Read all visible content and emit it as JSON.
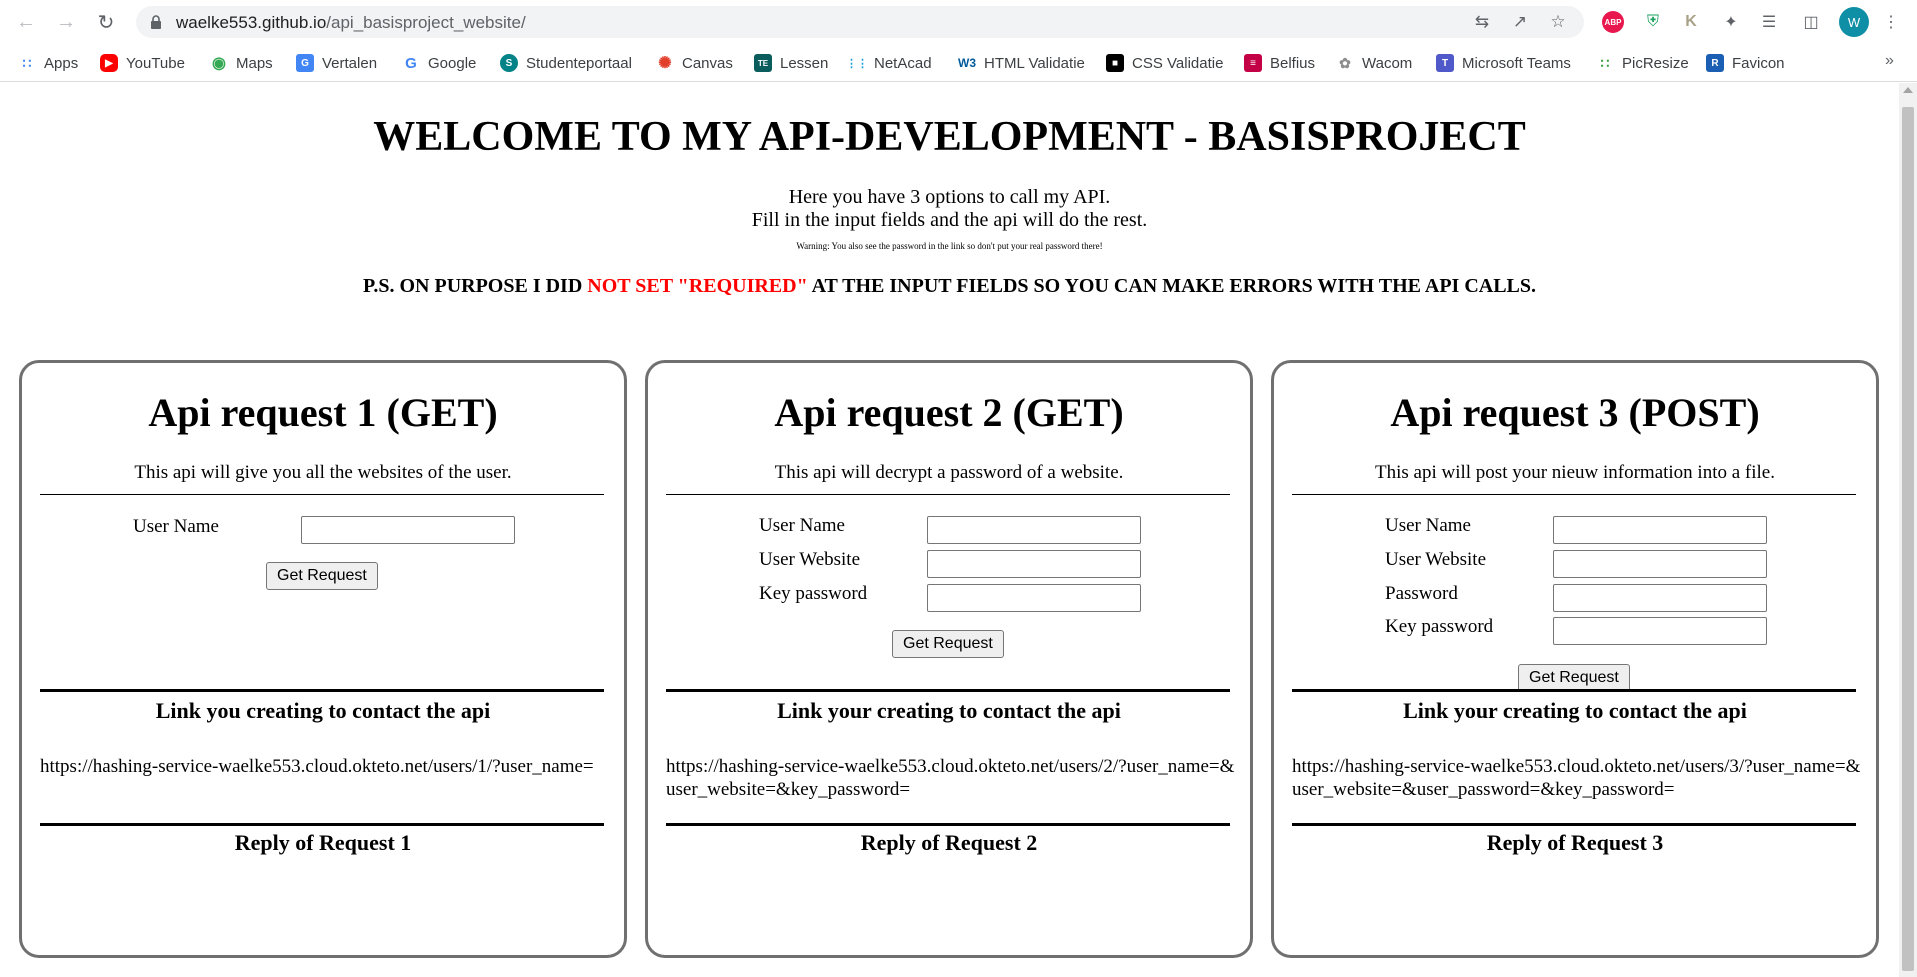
{
  "browser": {
    "url_domain": "waelke553.github.io",
    "url_path": "/api_basisproject_website/",
    "profile_initial": "W",
    "bookmarks": [
      {
        "label": "Apps",
        "icon": "apps-grid-icon",
        "color": "#4285f4"
      },
      {
        "label": "YouTube",
        "icon": "youtube-icon",
        "color": "#ff0000"
      },
      {
        "label": "Maps",
        "icon": "maps-pin-icon",
        "color": "#34a853"
      },
      {
        "label": "Vertalen",
        "icon": "translate-icon",
        "color": "#4285f4"
      },
      {
        "label": "Google",
        "icon": "google-icon",
        "color": "#4285f4"
      },
      {
        "label": "Studenteportaal",
        "icon": "sharepoint-icon",
        "color": "#038387"
      },
      {
        "label": "Canvas",
        "icon": "canvas-icon",
        "color": "#e13f2b"
      },
      {
        "label": "Lessen",
        "icon": "lessen-icon",
        "color": "#0b5d5d"
      },
      {
        "label": "NetAcad",
        "icon": "cisco-icon",
        "color": "#1ba0d7"
      },
      {
        "label": "HTML Validatie",
        "icon": "w3c-icon",
        "color": "#005a9c"
      },
      {
        "label": "CSS Validatie",
        "icon": "css-validator-icon",
        "color": "#000000"
      },
      {
        "label": "Belfius",
        "icon": "belfius-icon",
        "color": "#c30045"
      },
      {
        "label": "Wacom",
        "icon": "wacom-icon",
        "color": "#8e8e8e"
      },
      {
        "label": "Microsoft Teams",
        "icon": "teams-icon",
        "color": "#5059c9"
      },
      {
        "label": "PicResize",
        "icon": "picresize-icon",
        "color": "#3c9b3c"
      },
      {
        "label": "Favicon",
        "icon": "favicon-icon",
        "color": "#1a5fb4"
      }
    ]
  },
  "page": {
    "title": "WELCOME TO MY API-DEVELOPMENT - BASISPROJECT",
    "intro_line1": "Here you have 3 options to call my API.",
    "intro_line2": "Fill in the input fields and the api will do the rest.",
    "warning": "Warning: You also see the password in the link so don't put your real password there!",
    "ps_before": "P.S. ON PURPOSE I DID ",
    "ps_red": "NOT SET \"REQUIRED\"",
    "ps_after": " AT THE INPUT FIELDS SO YOU CAN MAKE ERRORS WITH THE API CALLS.",
    "accent_red": "#ff0000"
  },
  "cards": [
    {
      "title": "Api request 1 (GET)",
      "description": "This api will give you all the websites of the user.",
      "fields": [
        {
          "label": "User Name",
          "value": ""
        }
      ],
      "button_label": "Get Request",
      "link_heading": "Link you creating to contact the api",
      "link": "https://hashing-service-waelke553.cloud.okteto.net/users/1/?user_name=",
      "reply_heading": "Reply of Request 1"
    },
    {
      "title": "Api request 2 (GET)",
      "description": "This api will decrypt a password of a website.",
      "fields": [
        {
          "label": "User Name",
          "value": ""
        },
        {
          "label": "User Website",
          "value": ""
        },
        {
          "label": "Key password",
          "value": ""
        }
      ],
      "button_label": "Get Request",
      "link_heading": "Link your creating to contact the api",
      "link": "https://hashing-service-waelke553.cloud.okteto.net/users/2/?user_name=&user_website=&key_password=",
      "reply_heading": "Reply of Request 2"
    },
    {
      "title": "Api request 3 (POST)",
      "description": "This api will post your nieuw information into a file.",
      "fields": [
        {
          "label": "User Name",
          "value": ""
        },
        {
          "label": "User Website",
          "value": ""
        },
        {
          "label": "Password",
          "value": ""
        },
        {
          "label": "Key password",
          "value": ""
        }
      ],
      "button_label": "Get Request",
      "link_heading": "Link your creating to contact the api",
      "link": "https://hashing-service-waelke553.cloud.okteto.net/users/3/?user_name=&user_website=&user_password=&key_password=",
      "reply_heading": "Reply of Request 3"
    }
  ]
}
